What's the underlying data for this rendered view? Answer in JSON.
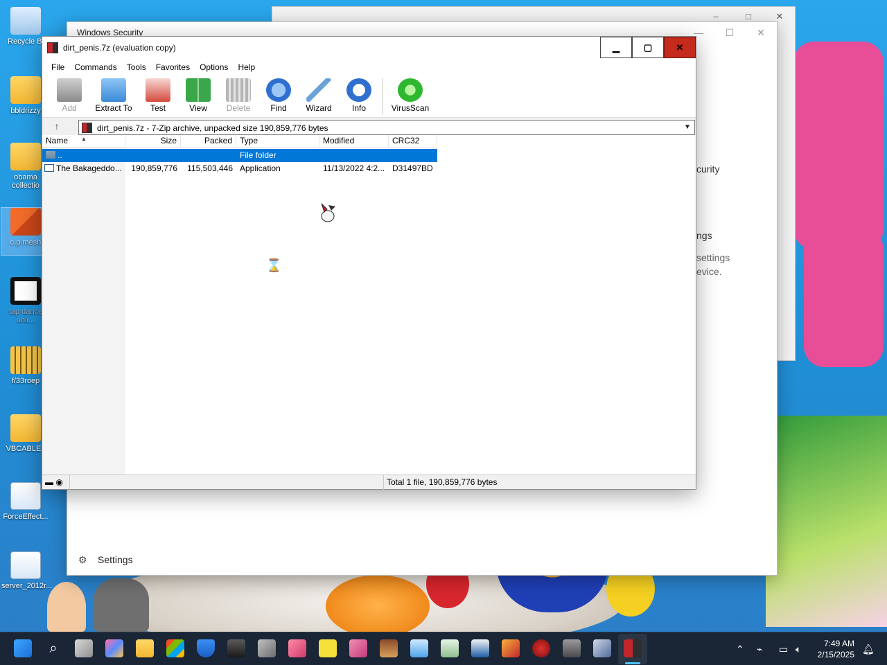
{
  "desktop": {
    "icons": [
      {
        "label": "Recycle Bi"
      },
      {
        "label": "bbldrizzy"
      },
      {
        "label": "obama collectio"
      },
      {
        "label": "c.p.mesh"
      },
      {
        "label": "tap dance unli..."
      },
      {
        "label": "f/33roep"
      },
      {
        "label": "VBCABLE_"
      },
      {
        "label": "ForceEffect..."
      },
      {
        "label": "server_2012r..."
      }
    ]
  },
  "browser": {
    "min": "–",
    "max": "□",
    "close": "✕"
  },
  "windows_security": {
    "title": "Windows Security",
    "min": "—",
    "max": "☐",
    "close": "✕",
    "fragments": [
      "curity",
      "ngs",
      "settings",
      "evice."
    ],
    "settings_label": "Settings"
  },
  "zip": {
    "title": "dirt_penis.7z (evaluation copy)",
    "min": "▁",
    "max": "▢",
    "close": "✕",
    "menu": [
      "File",
      "Commands",
      "Tools",
      "Favorites",
      "Options",
      "Help"
    ],
    "toolbar": [
      {
        "label": "Add",
        "icon": "add-icon",
        "disabled": true,
        "color": "#8a8a8a"
      },
      {
        "label": "Extract To",
        "icon": "extract-icon",
        "disabled": false,
        "color": "#3a8ad8"
      },
      {
        "label": "Test",
        "icon": "test-icon",
        "disabled": false,
        "color": "#d44b3d"
      },
      {
        "label": "View",
        "icon": "view-icon",
        "disabled": false,
        "color": "#3aa84a"
      },
      {
        "label": "Delete",
        "icon": "delete-icon",
        "disabled": true,
        "color": "#a0a0a0"
      },
      {
        "label": "Find",
        "icon": "find-icon",
        "disabled": false,
        "color": "#2f6fcf"
      },
      {
        "label": "Wizard",
        "icon": "wizard-icon",
        "disabled": false,
        "color": "#6aa3d8"
      },
      {
        "label": "Info",
        "icon": "info-icon",
        "disabled": false,
        "color": "#2f6fcf"
      },
      {
        "label": "VirusScan",
        "icon": "virusscan-icon",
        "disabled": false,
        "color": "#2fb72f"
      }
    ],
    "address": "dirt_penis.7z - 7-Zip archive, unpacked size 190,859,776 bytes",
    "columns": [
      "Name",
      "Size",
      "Packed",
      "Type",
      "Modified",
      "CRC32"
    ],
    "rows": [
      {
        "name": "..",
        "size": "",
        "packed": "",
        "type": "File folder",
        "modified": "",
        "crc": "",
        "selected": true
      },
      {
        "name": "The Bakageddo...",
        "size": "190,859,776",
        "packed": "115,503,446",
        "type": "Application",
        "modified": "11/13/2022 4:2...",
        "crc": "D31497BD",
        "selected": false
      }
    ],
    "status": "Total 1 file, 190,859,776 bytes"
  },
  "taskbar": {
    "time": "7:49 AM",
    "date": "2/15/2025"
  },
  "colors": {
    "selection": "#0078d7",
    "close_red": "#c42b1c",
    "taskbar": "#1a2535"
  }
}
